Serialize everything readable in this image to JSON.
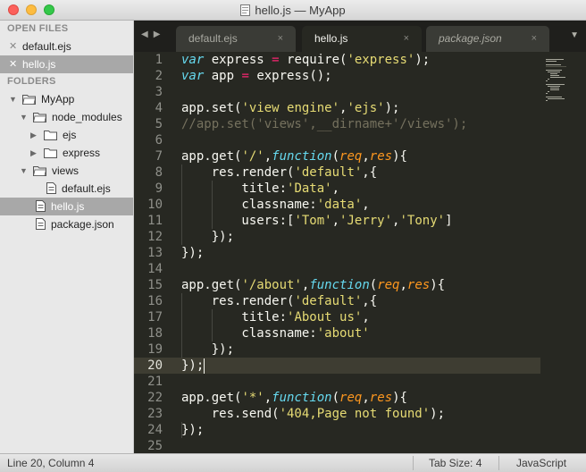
{
  "window": {
    "title": "hello.js — MyApp"
  },
  "sidebar": {
    "open_files_heading": "OPEN FILES",
    "open_files": [
      {
        "label": "default.ejs",
        "selected": false
      },
      {
        "label": "hello.js",
        "selected": true
      }
    ],
    "folders_heading": "FOLDERS",
    "tree": [
      {
        "label": "MyApp",
        "type": "folder",
        "expanded": true
      },
      {
        "label": "node_modules",
        "type": "folder",
        "expanded": true
      },
      {
        "label": "ejs",
        "type": "folder",
        "expanded": false
      },
      {
        "label": "express",
        "type": "folder",
        "expanded": false
      },
      {
        "label": "views",
        "type": "folder",
        "expanded": true
      },
      {
        "label": "default.ejs",
        "type": "file"
      },
      {
        "label": "hello.js",
        "type": "file",
        "selected": true
      },
      {
        "label": "package.json",
        "type": "file"
      }
    ]
  },
  "tabs": [
    {
      "label": "default.ejs",
      "active": false,
      "close": "×"
    },
    {
      "label": "hello.js",
      "active": true,
      "close": "×"
    },
    {
      "label": "package.json",
      "active": false,
      "close": "×"
    }
  ],
  "editor": {
    "current_line": 20,
    "line_numbers": [
      "1",
      "2",
      "3",
      "4",
      "5",
      "6",
      "7",
      "8",
      "9",
      "10",
      "11",
      "12",
      "13",
      "14",
      "15",
      "16",
      "17",
      "18",
      "19",
      "20",
      "21",
      "22",
      "23",
      "24",
      "25"
    ],
    "lines": [
      "var express = require('express');",
      "var app = express();",
      "",
      "app.set('view engine','ejs');",
      "//app.set('views',__dirname+'/views');",
      "",
      "app.get('/',function(req,res){",
      "    res.render('default',{",
      "        title:'Data',",
      "        classname:'data',",
      "        users:['Tom','Jerry','Tony']",
      "    });",
      "});",
      "",
      "app.get('/about',function(req,res){",
      "    res.render('default',{",
      "        title:'About us',",
      "        classname:'about'",
      "    });",
      "});",
      "",
      "app.get('*',function(req,res){",
      "    res.send('404,Page not found');",
      "});",
      ""
    ]
  },
  "statusbar": {
    "position": "Line 20, Column 4",
    "tab_size": "Tab Size: 4",
    "syntax": "JavaScript"
  },
  "colors": {
    "editor_bg": "#272822",
    "keyword": "#66d9ef",
    "operator": "#f92672",
    "string": "#e6db74",
    "comment": "#75715e",
    "param": "#fd971f"
  }
}
